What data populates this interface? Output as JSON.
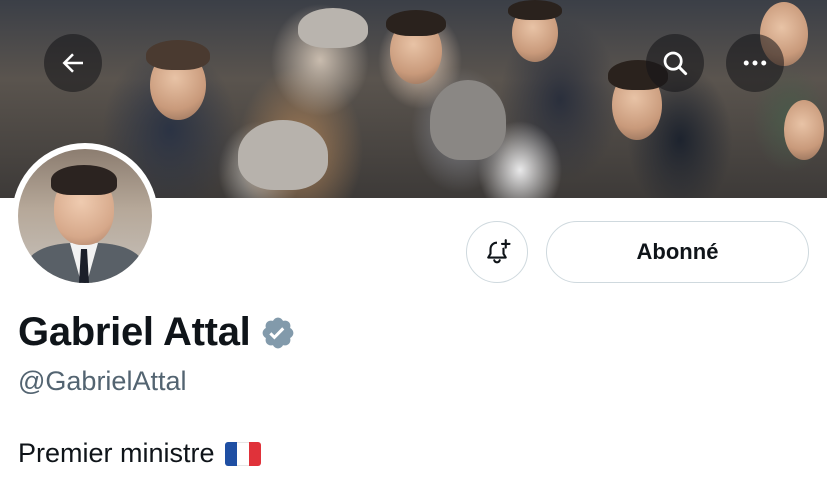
{
  "header": {
    "back_icon": "arrow-left-icon",
    "search_icon": "search-icon",
    "more_icon": "more-horizontal-icon"
  },
  "profile": {
    "display_name": "Gabriel Attal",
    "handle": "@GabrielAttal",
    "bio": "Premier ministre",
    "bio_flag_icon": "france-flag-icon",
    "verified_icon": "verified-badge-icon",
    "verified_color": "#829aab"
  },
  "actions": {
    "notify_icon": "bell-plus-icon",
    "follow_label": "Abonné"
  },
  "colors": {
    "text_primary": "#0f1419",
    "text_secondary": "#536471",
    "button_border": "#cfd9de"
  }
}
